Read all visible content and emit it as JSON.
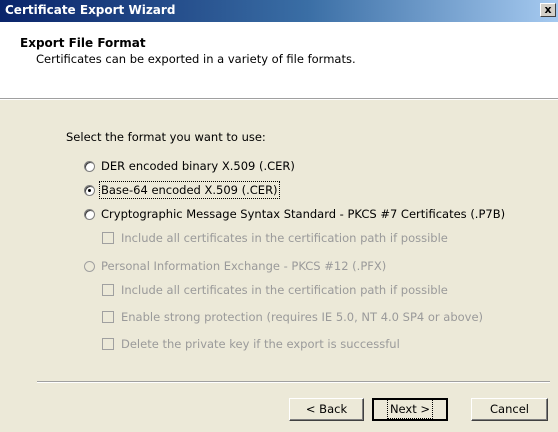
{
  "window": {
    "title": "Certificate Export Wizard",
    "close_glyph": "x"
  },
  "header": {
    "title": "Export File Format",
    "subtitle": "Certificates can be exported in a variety of file formats."
  },
  "main": {
    "prompt": "Select the format you want to use:",
    "options": [
      {
        "label": "DER encoded binary X.509 (.CER)",
        "type": "radio",
        "checked": false,
        "enabled": true
      },
      {
        "label": "Base-64 encoded X.509 (.CER)",
        "type": "radio",
        "checked": true,
        "enabled": true
      },
      {
        "label": "Cryptographic Message Syntax Standard - PKCS #7 Certificates (.P7B)",
        "type": "radio",
        "checked": false,
        "enabled": true
      },
      {
        "label": "Include all certificates in the certification path if possible",
        "type": "checkbox",
        "checked": false,
        "enabled": false
      },
      {
        "label": "Personal Information Exchange - PKCS #12 (.PFX)",
        "type": "radio",
        "checked": false,
        "enabled": false
      },
      {
        "label": "Include all certificates in the certification path if possible",
        "type": "checkbox",
        "checked": false,
        "enabled": false
      },
      {
        "label": "Enable strong protection (requires IE 5.0, NT 4.0 SP4 or above)",
        "type": "checkbox",
        "checked": false,
        "enabled": false
      },
      {
        "label": "Delete the private key if the export is successful",
        "type": "checkbox",
        "checked": false,
        "enabled": false
      }
    ]
  },
  "footer": {
    "back_label": "< Back",
    "next_label": "Next >",
    "cancel_label": "Cancel"
  },
  "colors": {
    "titlebar_start": "#0a246a",
    "dialog_face": "#ece9d8",
    "disabled_text": "#9a9a9a"
  }
}
